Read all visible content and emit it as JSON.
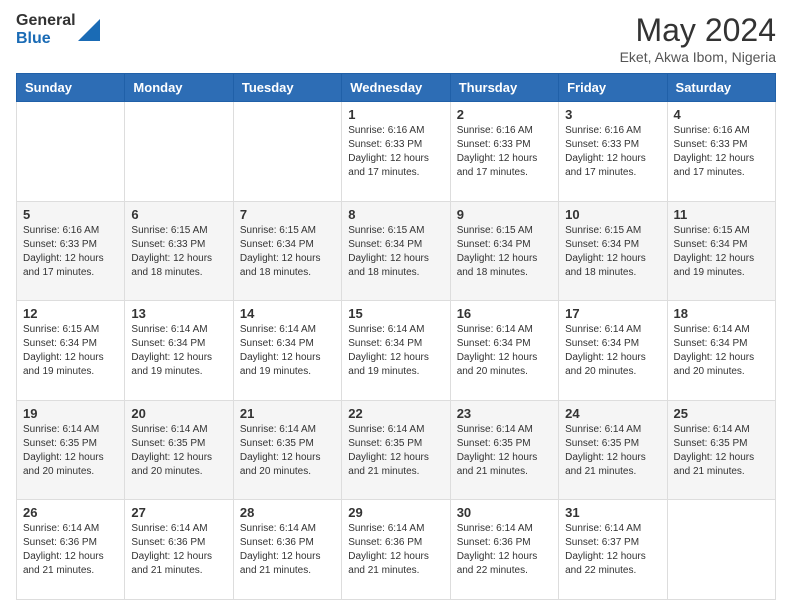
{
  "header": {
    "logo_line1": "General",
    "logo_line2": "Blue",
    "month": "May 2024",
    "location": "Eket, Akwa Ibom, Nigeria"
  },
  "days_of_week": [
    "Sunday",
    "Monday",
    "Tuesday",
    "Wednesday",
    "Thursday",
    "Friday",
    "Saturday"
  ],
  "weeks": [
    [
      {
        "day": "",
        "info": ""
      },
      {
        "day": "",
        "info": ""
      },
      {
        "day": "",
        "info": ""
      },
      {
        "day": "1",
        "info": "Sunrise: 6:16 AM\nSunset: 6:33 PM\nDaylight: 12 hours\nand 17 minutes."
      },
      {
        "day": "2",
        "info": "Sunrise: 6:16 AM\nSunset: 6:33 PM\nDaylight: 12 hours\nand 17 minutes."
      },
      {
        "day": "3",
        "info": "Sunrise: 6:16 AM\nSunset: 6:33 PM\nDaylight: 12 hours\nand 17 minutes."
      },
      {
        "day": "4",
        "info": "Sunrise: 6:16 AM\nSunset: 6:33 PM\nDaylight: 12 hours\nand 17 minutes."
      }
    ],
    [
      {
        "day": "5",
        "info": "Sunrise: 6:16 AM\nSunset: 6:33 PM\nDaylight: 12 hours\nand 17 minutes."
      },
      {
        "day": "6",
        "info": "Sunrise: 6:15 AM\nSunset: 6:33 PM\nDaylight: 12 hours\nand 18 minutes."
      },
      {
        "day": "7",
        "info": "Sunrise: 6:15 AM\nSunset: 6:34 PM\nDaylight: 12 hours\nand 18 minutes."
      },
      {
        "day": "8",
        "info": "Sunrise: 6:15 AM\nSunset: 6:34 PM\nDaylight: 12 hours\nand 18 minutes."
      },
      {
        "day": "9",
        "info": "Sunrise: 6:15 AM\nSunset: 6:34 PM\nDaylight: 12 hours\nand 18 minutes."
      },
      {
        "day": "10",
        "info": "Sunrise: 6:15 AM\nSunset: 6:34 PM\nDaylight: 12 hours\nand 18 minutes."
      },
      {
        "day": "11",
        "info": "Sunrise: 6:15 AM\nSunset: 6:34 PM\nDaylight: 12 hours\nand 19 minutes."
      }
    ],
    [
      {
        "day": "12",
        "info": "Sunrise: 6:15 AM\nSunset: 6:34 PM\nDaylight: 12 hours\nand 19 minutes."
      },
      {
        "day": "13",
        "info": "Sunrise: 6:14 AM\nSunset: 6:34 PM\nDaylight: 12 hours\nand 19 minutes."
      },
      {
        "day": "14",
        "info": "Sunrise: 6:14 AM\nSunset: 6:34 PM\nDaylight: 12 hours\nand 19 minutes."
      },
      {
        "day": "15",
        "info": "Sunrise: 6:14 AM\nSunset: 6:34 PM\nDaylight: 12 hours\nand 19 minutes."
      },
      {
        "day": "16",
        "info": "Sunrise: 6:14 AM\nSunset: 6:34 PM\nDaylight: 12 hours\nand 20 minutes."
      },
      {
        "day": "17",
        "info": "Sunrise: 6:14 AM\nSunset: 6:34 PM\nDaylight: 12 hours\nand 20 minutes."
      },
      {
        "day": "18",
        "info": "Sunrise: 6:14 AM\nSunset: 6:34 PM\nDaylight: 12 hours\nand 20 minutes."
      }
    ],
    [
      {
        "day": "19",
        "info": "Sunrise: 6:14 AM\nSunset: 6:35 PM\nDaylight: 12 hours\nand 20 minutes."
      },
      {
        "day": "20",
        "info": "Sunrise: 6:14 AM\nSunset: 6:35 PM\nDaylight: 12 hours\nand 20 minutes."
      },
      {
        "day": "21",
        "info": "Sunrise: 6:14 AM\nSunset: 6:35 PM\nDaylight: 12 hours\nand 20 minutes."
      },
      {
        "day": "22",
        "info": "Sunrise: 6:14 AM\nSunset: 6:35 PM\nDaylight: 12 hours\nand 21 minutes."
      },
      {
        "day": "23",
        "info": "Sunrise: 6:14 AM\nSunset: 6:35 PM\nDaylight: 12 hours\nand 21 minutes."
      },
      {
        "day": "24",
        "info": "Sunrise: 6:14 AM\nSunset: 6:35 PM\nDaylight: 12 hours\nand 21 minutes."
      },
      {
        "day": "25",
        "info": "Sunrise: 6:14 AM\nSunset: 6:35 PM\nDaylight: 12 hours\nand 21 minutes."
      }
    ],
    [
      {
        "day": "26",
        "info": "Sunrise: 6:14 AM\nSunset: 6:36 PM\nDaylight: 12 hours\nand 21 minutes."
      },
      {
        "day": "27",
        "info": "Sunrise: 6:14 AM\nSunset: 6:36 PM\nDaylight: 12 hours\nand 21 minutes."
      },
      {
        "day": "28",
        "info": "Sunrise: 6:14 AM\nSunset: 6:36 PM\nDaylight: 12 hours\nand 21 minutes."
      },
      {
        "day": "29",
        "info": "Sunrise: 6:14 AM\nSunset: 6:36 PM\nDaylight: 12 hours\nand 21 minutes."
      },
      {
        "day": "30",
        "info": "Sunrise: 6:14 AM\nSunset: 6:36 PM\nDaylight: 12 hours\nand 22 minutes."
      },
      {
        "day": "31",
        "info": "Sunrise: 6:14 AM\nSunset: 6:37 PM\nDaylight: 12 hours\nand 22 minutes."
      },
      {
        "day": "",
        "info": ""
      }
    ]
  ]
}
